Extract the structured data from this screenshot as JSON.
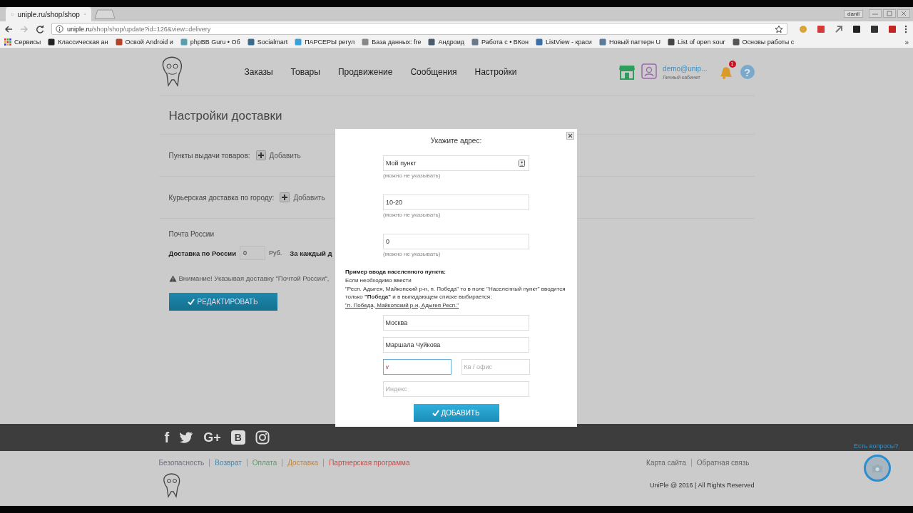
{
  "browser": {
    "tab_title": "uniple.ru/shop/shop",
    "user": "danil",
    "url_host": "uniple.ru",
    "url_path": "/shop/shop/update?id=126&view=delivery",
    "apps_label": "Сервисы",
    "bookmarks": [
      {
        "label": "Классическая ан",
        "color": "#222222"
      },
      {
        "label": "Освой Android и",
        "color": "#b0452a"
      },
      {
        "label": "phpBB Guru • Об",
        "color": "#5a9fb0"
      },
      {
        "label": "Socialmart",
        "color": "#3b6b8a"
      },
      {
        "label": "ПАРСЕРЫ регул",
        "color": "#3aa0d8"
      },
      {
        "label": "База данных: fre",
        "color": "#888888"
      },
      {
        "label": "Андроид",
        "color": "#4a5a6a"
      },
      {
        "label": "Работа с • ВКон",
        "color": "#6a7a8a"
      },
      {
        "label": "ListView - краси",
        "color": "#3a6ea5"
      },
      {
        "label": "Новый паттерн U",
        "color": "#5a7a9a"
      },
      {
        "label": "List of open sour",
        "color": "#444444"
      },
      {
        "label": "Основы работы с",
        "color": "#555555"
      }
    ],
    "more": "»"
  },
  "header": {
    "nav": [
      "Заказы",
      "Товары",
      "Продвижение",
      "Сообщения",
      "Настройки"
    ],
    "account": {
      "email": "demo@unip...",
      "caption": "Личный кабинет"
    },
    "notifications": "1",
    "help_glyph": "?"
  },
  "page": {
    "title": "Настройки доставки",
    "sections": [
      {
        "label": "Пункты выдачи товаров:",
        "action": "Добавить"
      },
      {
        "label": "Курьерская доставка по городу:",
        "action": "Добавить"
      }
    ],
    "post": {
      "title": "Почта России",
      "label": "Доставка по России",
      "value": "0",
      "unit": "Руб.",
      "extra": "За каждый д",
      "warning": "Внимание! Указывая доставку \"Почтой России\","
    },
    "edit_button": "РЕДАКТИРОВАТЬ"
  },
  "modal": {
    "title": "Укажите адрес:",
    "fields": [
      {
        "value": "Мой пункт",
        "hint": "(можно не указывать)",
        "kind": "contact"
      },
      {
        "value": "10-20",
        "hint": "(можно не указывать)",
        "kind": "plain"
      },
      {
        "value": "0",
        "hint": "(можно не указывать)",
        "kind": "plain"
      }
    ],
    "example": {
      "title": "Пример ввода населенного пункта:",
      "lines": [
        "Если необходимо ввести",
        "\"Респ. Адыгея, Майкопский р-н, п. Победа\" то в поле \"Населенный пункт\" вводится только **\"Победа\"** и в выпадающем списке выбирается:"
      ],
      "link": "\"п. Победа, Майкопский р-н, Адыгея Респ.\""
    },
    "address_fields": [
      {
        "kind": "full",
        "value": "Москва",
        "focused": false
      },
      {
        "kind": "full",
        "value": "Маршала Чуйкова",
        "focused": false
      },
      {
        "kind": "half",
        "value": "v",
        "focused": true
      },
      {
        "kind": "half",
        "placeholder": "Кв / офис",
        "focused": false
      },
      {
        "kind": "full",
        "placeholder": "Индекс",
        "focused": false
      }
    ],
    "submit": "ДОБАВИТЬ"
  },
  "footer": {
    "social": [
      {
        "kind": "facebook",
        "glyph": "f"
      },
      {
        "kind": "twitter"
      },
      {
        "kind": "googleplus",
        "glyph": "G+"
      },
      {
        "kind": "vk",
        "glyph": "B"
      },
      {
        "kind": "instagram"
      }
    ],
    "links": [
      {
        "label": "Безопасность",
        "color": "#716c82"
      },
      {
        "label": "Возврат",
        "color": "#4a86a8"
      },
      {
        "label": "Оплата",
        "color": "#5c9a6c"
      },
      {
        "label": "Доставка",
        "color": "#c4843a"
      },
      {
        "label": "Партнерская программа",
        "color": "#c24f4f"
      }
    ],
    "right_links": [
      "Карта сайта",
      "Обратная связь"
    ],
    "copyright": "UniPle @ 2016 | All Rights Reserved",
    "help": "Есть вопросы?"
  }
}
